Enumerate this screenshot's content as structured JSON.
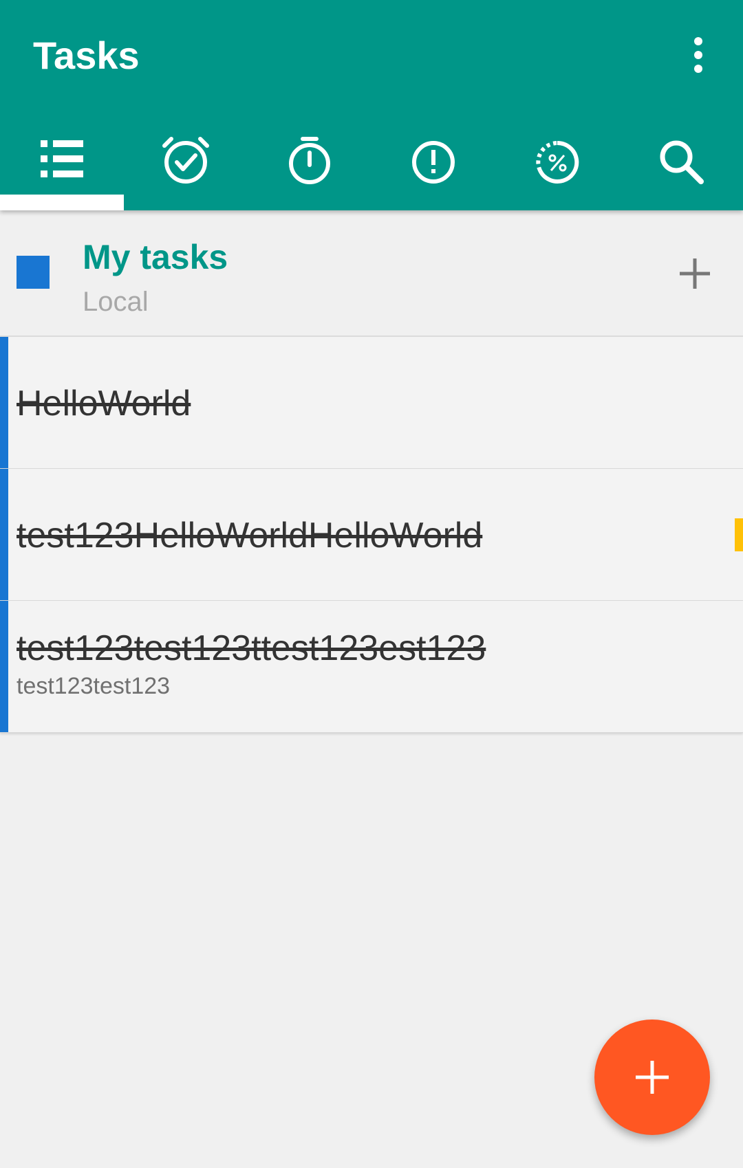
{
  "app": {
    "title": "Tasks",
    "overflow_icon": "more-vert-icon"
  },
  "colors": {
    "primary": "#009688",
    "list_color": "#1976d2",
    "list_name": "#009688",
    "priority": "#ffc107",
    "fab": "#ff5722"
  },
  "tabs": [
    {
      "icon": "list-icon",
      "selected": true
    },
    {
      "icon": "alarm-check-icon",
      "selected": false
    },
    {
      "icon": "stopwatch-icon",
      "selected": false
    },
    {
      "icon": "priority-alert-icon",
      "selected": false
    },
    {
      "icon": "progress-percent-icon",
      "selected": false
    },
    {
      "icon": "search-icon",
      "selected": false
    }
  ],
  "list_header": {
    "name": "My tasks",
    "account": "Local",
    "add_icon": "plus-icon"
  },
  "tasks": [
    {
      "title": "HelloWorld",
      "description": "",
      "completed": true
    },
    {
      "title": "test123HelloWorldHelloWorld",
      "description": "",
      "completed": true,
      "priority": true
    },
    {
      "title": "test123test123ttest123est123",
      "description": "test123test123",
      "completed": true
    }
  ],
  "fab": {
    "icon": "plus-icon"
  }
}
